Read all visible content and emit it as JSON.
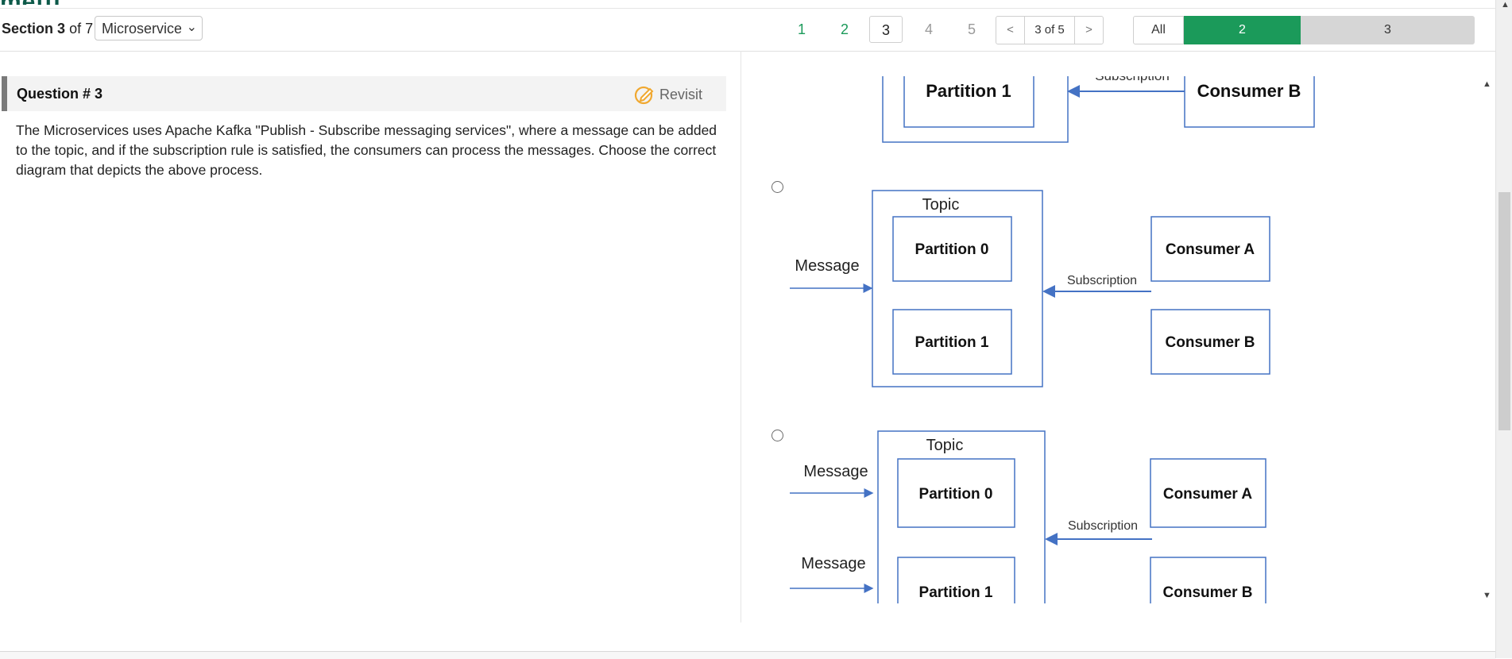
{
  "app": {
    "logo_text": "mettl"
  },
  "section": {
    "label_prefix": "Section",
    "number": "3",
    "of_label": "of 7",
    "select_value": "Microservice"
  },
  "pages": {
    "items": [
      "1",
      "2",
      "3",
      "4",
      "5"
    ],
    "pager_prev": "<",
    "pager_status": "3 of 5",
    "pager_next": ">"
  },
  "filter": {
    "all_label": "All",
    "answered_count": "2",
    "unanswered_count": "3"
  },
  "question": {
    "title": "Question # 3",
    "revisit_label": "Revisit",
    "text": "The Microservices uses Apache Kafka \"Publish - Subscribe messaging services\", where a message can be added to the topic, and if the subscription rule is satisfied, the consumers can process the messages. Choose the correct diagram that depicts the above process."
  },
  "diagrams": {
    "top_partial": {
      "subscription_label": "Subscription",
      "partition1": "Partition 1",
      "consumer_b": "Consumer B"
    },
    "option_a": {
      "topic": "Topic",
      "message": "Message",
      "partition0": "Partition 0",
      "partition1": "Partition 1",
      "subscription": "Subscription",
      "consumer_a": "Consumer A",
      "consumer_b": "Consumer B"
    },
    "option_b": {
      "topic": "Topic",
      "message1": "Message",
      "message2": "Message",
      "partition0": "Partition 0",
      "partition1": "Partition 1",
      "subscription": "Subscription",
      "consumer_a": "Consumer A",
      "consumer_b": "Consumer B"
    }
  },
  "colors": {
    "accent_green": "#1b9a5a",
    "diagram_blue": "#4472c4"
  }
}
